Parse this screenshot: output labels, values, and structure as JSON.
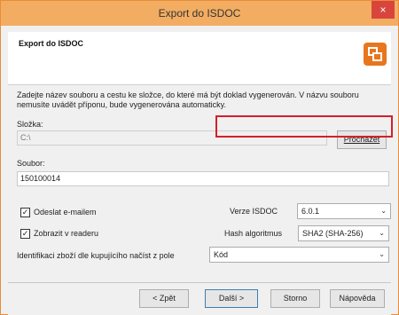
{
  "window": {
    "title": "Export do ISDOC",
    "close_glyph": "×"
  },
  "header": {
    "title": "Export do ISDOC",
    "logo_icon": "isdoc-logo-icon"
  },
  "intro_text": "Zadejte název souboru a cestu ke složce, do které má být doklad vygenerován. V názvu souboru nemusíte uvádět příponu, bude vygenerována automaticky.",
  "folder": {
    "label": "Složka:",
    "value": "C:\\",
    "browse_label": "Procházet"
  },
  "file": {
    "label": "Soubor:",
    "value": "150100014"
  },
  "options": {
    "send_email_label": "Odeslat e-mailem",
    "send_email_checked": true,
    "show_reader_label": "Zobrazit v readeru",
    "show_reader_checked": true,
    "version_label": "Verze ISDOC",
    "version_value": "6.0.1",
    "hash_label": "Hash algoritmus",
    "hash_value": "SHA2 (SHA-256)",
    "identify_label": "Identifikaci zboží dle kupujícího načíst z pole",
    "identify_value": "Kód"
  },
  "buttons": {
    "back": "< Zpět",
    "next": "Další >",
    "cancel": "Storno",
    "help": "Nápověda"
  },
  "colors": {
    "titlebar": "#f2ad62",
    "highlight_border": "#d41f2b",
    "logo": "#e8761e"
  }
}
